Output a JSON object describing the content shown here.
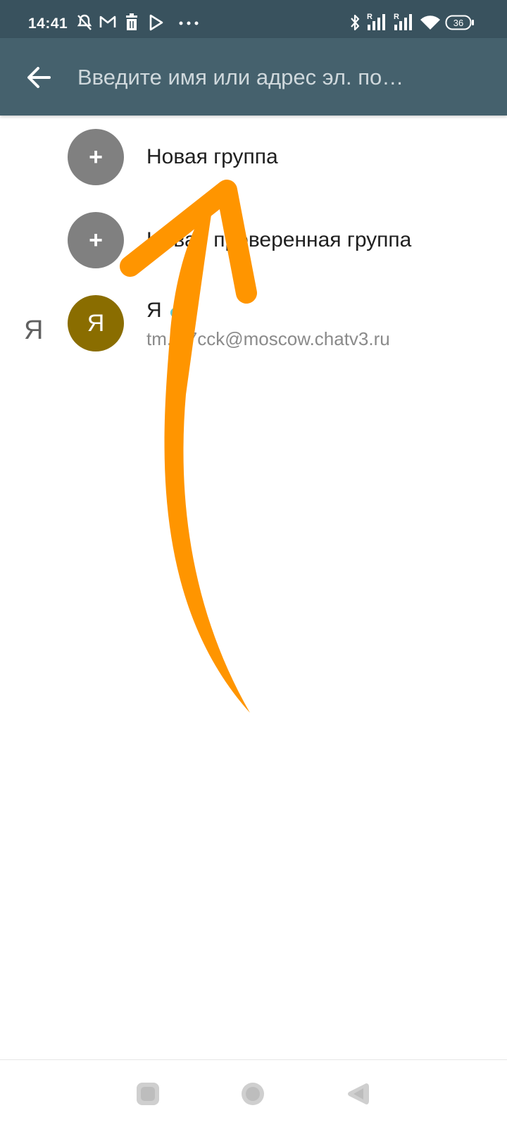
{
  "status_bar": {
    "time": "14:41",
    "left_icons": [
      "mute-icon",
      "gmail-icon",
      "trash-icon",
      "play-store-icon",
      "more-dots-icon"
    ],
    "right_icons": [
      "bluetooth-icon",
      "signal-roaming-icon",
      "signal-roaming-icon",
      "wifi-icon",
      "battery-icon"
    ],
    "roaming_label": "R",
    "battery_level": "36"
  },
  "app_bar": {
    "background": "#45616d",
    "search": {
      "placeholder": "Введите имя или адрес эл. по…",
      "value": ""
    }
  },
  "list": {
    "items": [
      {
        "avatar_text": "+",
        "title": "Новая группа"
      },
      {
        "avatar_text": "+",
        "title": "Новая проверенная группа"
      }
    ],
    "section_letter": "Я",
    "contact": {
      "avatar_text": "Я",
      "avatar_color": "#8a6d00",
      "name": "Я",
      "email": "tm..37cck@moscow.chatv3.ru"
    }
  },
  "annotation": {
    "color": "#ff9500",
    "icon": "curved-arrow-icon"
  }
}
